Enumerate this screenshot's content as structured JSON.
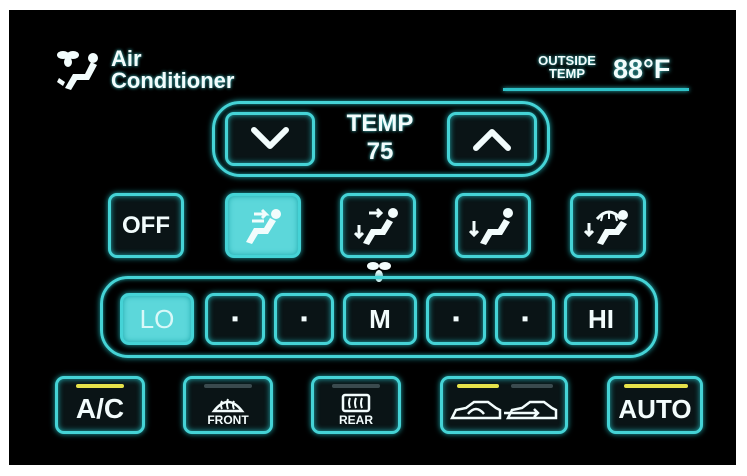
{
  "header": {
    "title_line1": "Air",
    "title_line2": "Conditioner",
    "outside_label_line1": "OUTSIDE",
    "outside_label_line2": "TEMP",
    "outside_temp": "88°F"
  },
  "temp": {
    "label": "TEMP",
    "value": "75",
    "down_icon": "chevron-down-icon",
    "up_icon": "chevron-up-icon"
  },
  "modes": {
    "off_label": "OFF",
    "icons": [
      "vent-face-icon",
      "vent-face-feet-icon",
      "vent-feet-icon",
      "vent-feet-defrost-icon"
    ]
  },
  "fan": {
    "icon": "fan-icon",
    "levels": [
      "LO",
      "▪",
      "▪",
      "M",
      "▪",
      "▪",
      "HI"
    ],
    "active_index": 0
  },
  "bottom": {
    "ac_label": "A/C",
    "front_label": "FRONT",
    "rear_label": "REAR",
    "auto_label": "AUTO",
    "ac_indicator": "on",
    "front_indicator": "off",
    "rear_indicator": "off",
    "recirc_indicator": "on",
    "fresh_indicator": "off",
    "auto_indicator": "on"
  },
  "colors": {
    "accent": "#45d3d6",
    "indicator_on": "#e5e24a",
    "indicator_off": "#3a4a4e",
    "background": "#000000"
  }
}
